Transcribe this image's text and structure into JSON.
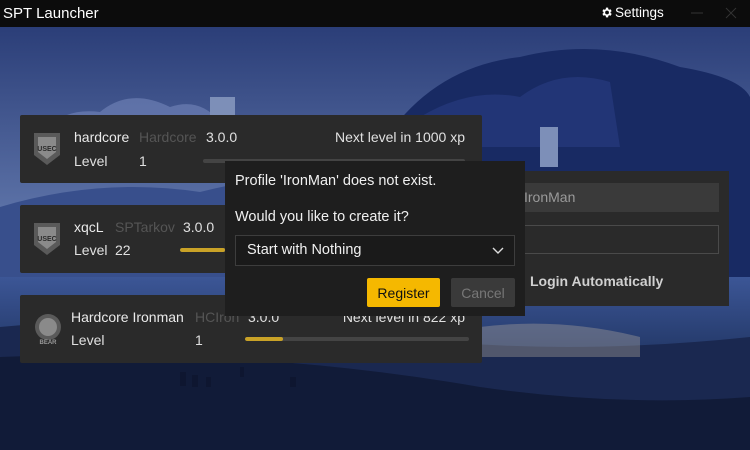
{
  "window": {
    "title": "SPT Launcher",
    "settings_label": "Settings"
  },
  "colors": {
    "accent": "#f5b800",
    "progress": "#c9a227",
    "card_bg": "#2a2a2a",
    "dialog_bg": "#1e1e1e"
  },
  "profiles": [
    {
      "name": "hardcore",
      "edition": "Hardcore",
      "version": "3.0.0",
      "next_label": "Next level in 1000 xp",
      "level_label": "Level",
      "level": "1",
      "progress": 0.0,
      "logo": "usec-logo-icon"
    },
    {
      "name": "xqcL",
      "edition": "SPTarkov",
      "version": "3.0.0",
      "next_label": "",
      "level_label": "Level",
      "level": "22",
      "progress": 0.45,
      "logo": "usec-logo-icon"
    },
    {
      "name": "Hardcore Ironman",
      "edition": "HCIron",
      "version": "3.0.0",
      "next_label": "Next level in 822 xp",
      "level_label": "Level",
      "level": "1",
      "progress": 0.17,
      "logo": "bear-logo-icon"
    }
  ],
  "login": {
    "username": "IronMan",
    "auto_login_label": "Login Automatically"
  },
  "dialog": {
    "message": "Profile 'IronMan' does not exist.",
    "question": "Would you like to create it?",
    "selected_option": "Start with Nothing",
    "register_label": "Register",
    "cancel_label": "Cancel"
  }
}
